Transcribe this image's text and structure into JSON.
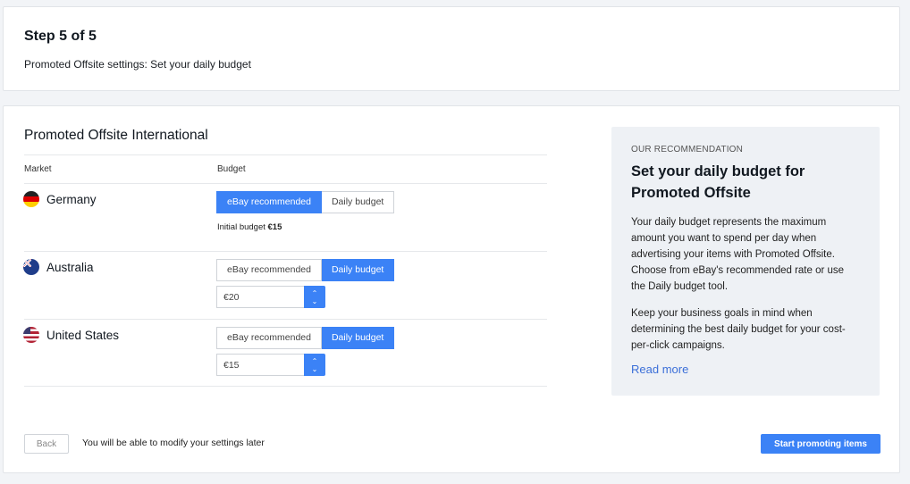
{
  "step": {
    "title": "Step 5 of 5",
    "subtitle": "Promoted Offsite settings: Set your daily budget"
  },
  "section": {
    "title": "Promoted Offsite International",
    "col_market": "Market",
    "col_budget": "Budget"
  },
  "markets": [
    {
      "country": "Germany",
      "flag_icon": "germany-flag-icon",
      "option_recommended": "eBay recommended",
      "option_daily": "Daily budget",
      "selected": "recommended",
      "initial_label": "Initial budget",
      "initial_value": "€15"
    },
    {
      "country": "Australia",
      "flag_icon": "australia-flag-icon",
      "option_recommended": "eBay recommended",
      "option_daily": "Daily budget",
      "selected": "daily",
      "budget_value": "€20"
    },
    {
      "country": "United States",
      "flag_icon": "us-flag-icon",
      "option_recommended": "eBay recommended",
      "option_daily": "Daily budget",
      "selected": "daily",
      "budget_value": "€15"
    }
  ],
  "recommendation": {
    "kicker": "OUR RECOMMENDATION",
    "title": "Set your daily budget for Promoted Offsite",
    "p1": "Your daily budget represents the maximum amount you want to spend per day when advertising your items with Promoted Offsite. Choose from eBay's recommended rate or use the Daily budget tool.",
    "p2": "Keep your business goals in mind when determining the best daily budget for your cost-per-click campaigns.",
    "link": "Read more"
  },
  "footer": {
    "back_label": "Back",
    "note": "You will be able to modify your settings later",
    "start_label": "Start promoting items"
  },
  "colors": {
    "accent": "#3b82f6",
    "panel": "#eef1f5",
    "link": "#3b6fd8"
  }
}
